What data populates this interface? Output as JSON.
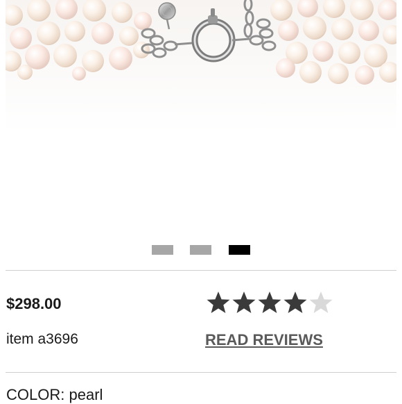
{
  "product": {
    "price": "$298.00",
    "item_number": "item a3696",
    "rating": 4,
    "rating_max": 5,
    "read_reviews_label": "READ REVIEWS",
    "color_label": "COLOR:",
    "color_value": "pearl"
  },
  "carousel": {
    "slide_count": 3,
    "active_index": 2
  },
  "colors": {
    "star_filled": "#3a3a3a",
    "star_empty": "#d9d9d9",
    "dot_inactive": "#a6a6a6",
    "dot_active": "#000000",
    "link": "#5a5a5a"
  },
  "icons": {
    "rating_star": "star-icon"
  }
}
